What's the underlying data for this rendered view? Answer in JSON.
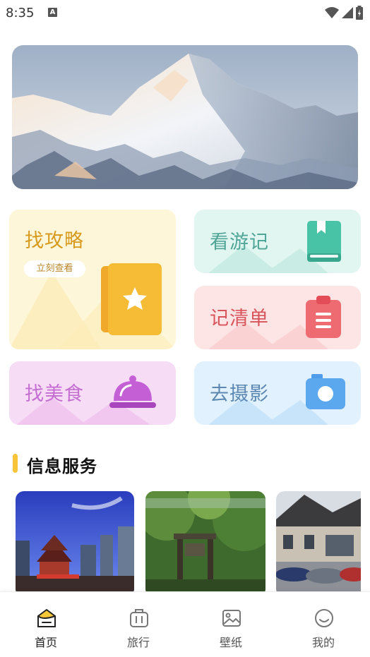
{
  "status_bar": {
    "time": "8:35",
    "notification_icon": "a-icon"
  },
  "banner": {
    "image": "snowy-mountain-photo"
  },
  "feature_cards": {
    "guide": {
      "title": "找攻略",
      "button": "立刻查看",
      "icon": "star-book-icon",
      "color": "#d89a1c"
    },
    "travelogue": {
      "title": "看游记",
      "icon": "book-icon",
      "color": "#4fa596"
    },
    "checklist": {
      "title": "记清单",
      "icon": "clipboard-icon",
      "color": "#d8545b"
    },
    "food": {
      "title": "找美食",
      "icon": "food-cloche-icon",
      "color": "#c46ed2"
    },
    "photo": {
      "title": "去摄影",
      "icon": "camera-icon",
      "color": "#5b87b0"
    }
  },
  "info_section": {
    "title": "信息服务",
    "items": [
      {
        "image": "city-pavilion-photo"
      },
      {
        "image": "forest-gate-photo"
      },
      {
        "image": "house-cars-photo"
      }
    ]
  },
  "tab_bar": {
    "tabs": [
      {
        "label": "首页",
        "icon": "home-icon",
        "active": true
      },
      {
        "label": "旅行",
        "icon": "luggage-icon",
        "active": false
      },
      {
        "label": "壁纸",
        "icon": "picture-icon",
        "active": false
      },
      {
        "label": "我的",
        "icon": "smile-icon",
        "active": false
      }
    ]
  }
}
